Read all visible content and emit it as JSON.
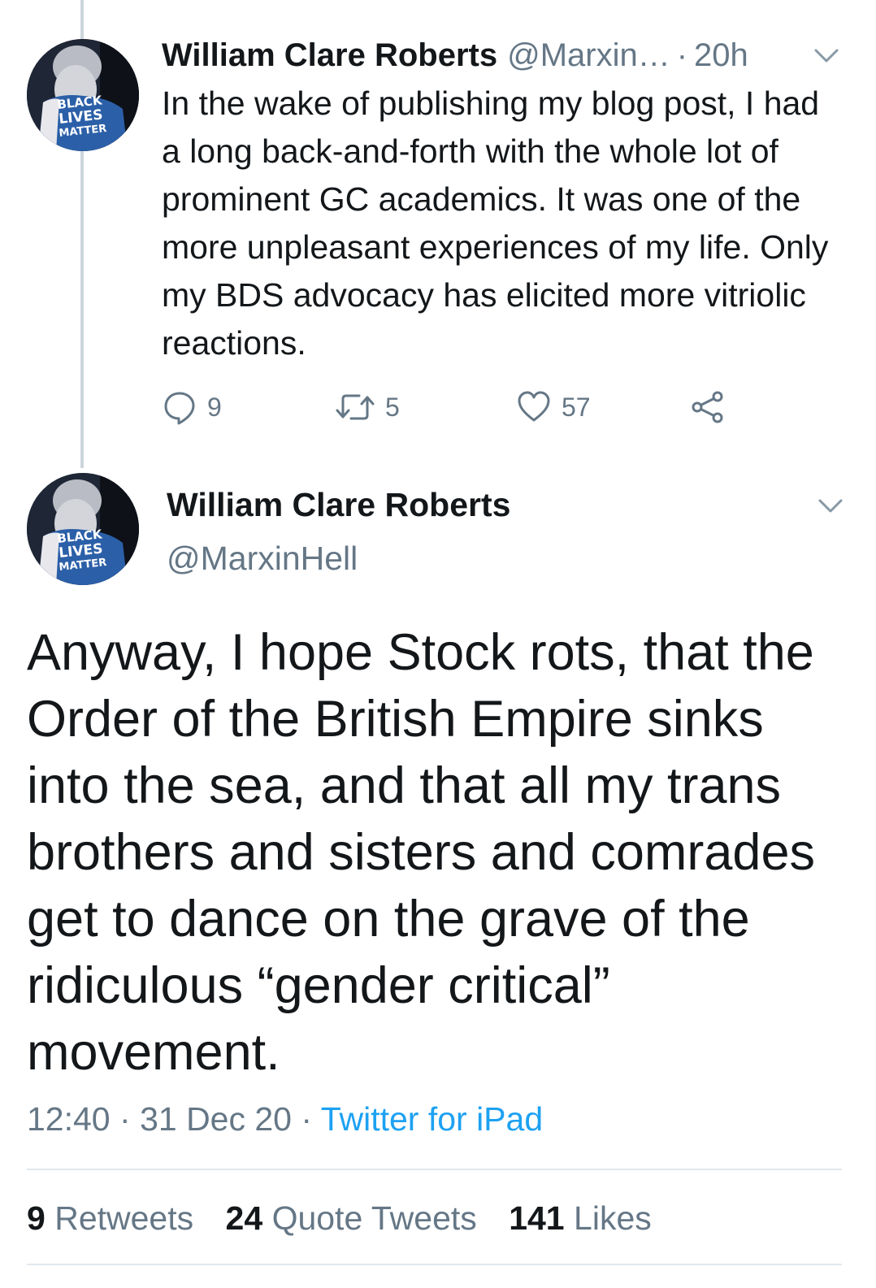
{
  "thread": {
    "parent": {
      "author_name": "William Clare Roberts",
      "author_handle": "@Marxin…",
      "separator": "·",
      "time": "20h",
      "avatar_text": [
        "BLACK",
        "LIVES",
        "MATTER"
      ],
      "text": "In the wake of publishing my blog post, I had a long back-and-forth with the whole lot of prominent GC academics. It was one of the more unpleasant experiences of my life. Only my BDS advocacy has elicited more vitriolic reactions.",
      "actions": {
        "reply_count": "9",
        "retweet_count": "5",
        "like_count": "57",
        "icons": [
          "reply-icon",
          "retweet-icon",
          "like-icon",
          "share-icon"
        ]
      }
    },
    "main": {
      "author_name": "William Clare Roberts",
      "author_handle": "@MarxinHell",
      "avatar_text": [
        "BLACK",
        "LIVES",
        "MATTER"
      ],
      "text": "Anyway, I hope Stock rots, that the Order of the British Empire sinks into the sea, and that all my trans brothers and sisters and comrades get to dance on the grave of the ridiculous “gender critical” movement.",
      "time": "12:40",
      "date": "31 Dec 20",
      "separator": "·",
      "source": "Twitter for iPad",
      "stats": {
        "retweets_count": "9",
        "retweets_label": "Retweets",
        "quotes_count": "24",
        "quotes_label": "Quote Tweets",
        "likes_count": "141",
        "likes_label": "Likes"
      }
    }
  },
  "colors": {
    "text": "#14171a",
    "secondary": "#657786",
    "link": "#1da1f2",
    "divider": "#e1e8ed",
    "thread_line": "#ccd6dd"
  }
}
